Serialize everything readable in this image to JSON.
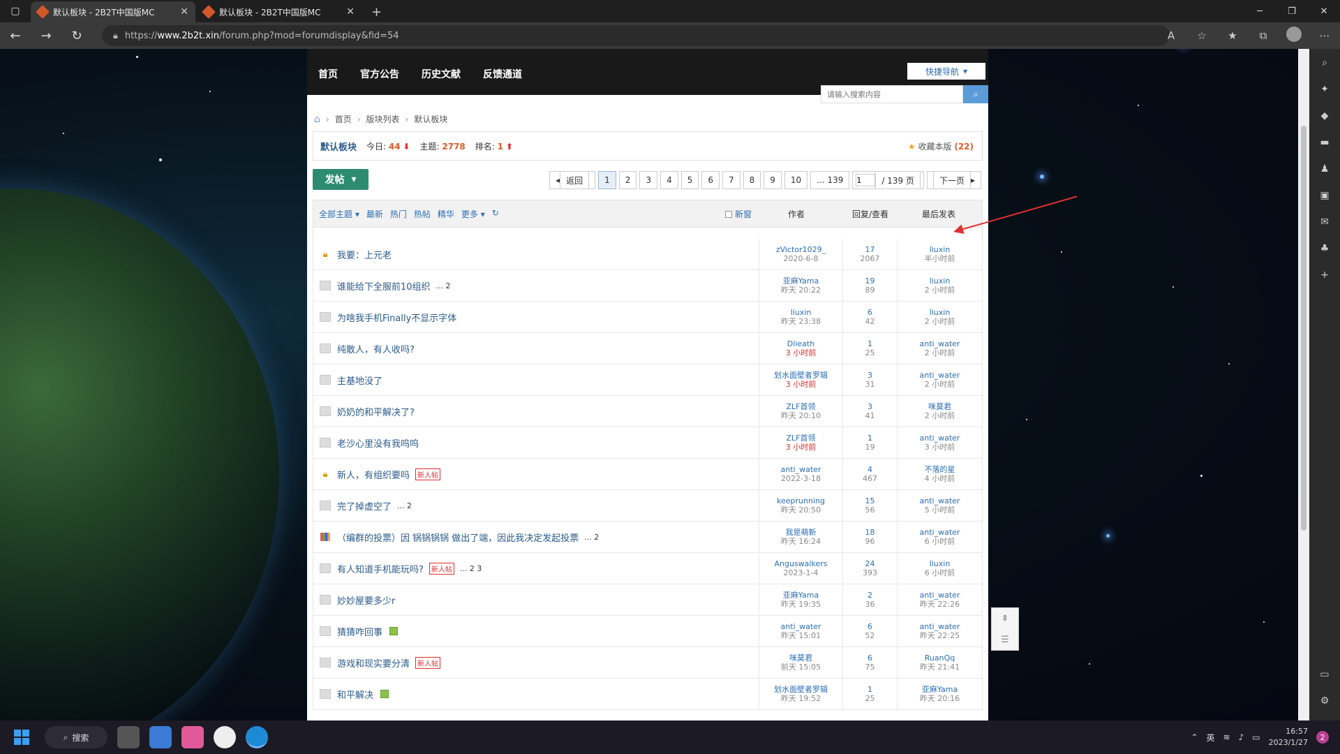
{
  "browser": {
    "tabs": [
      {
        "title": "默认板块 - 2B2T中国版MC",
        "active": true
      },
      {
        "title": "默认板块 - 2B2T中国版MC",
        "active": false
      }
    ],
    "url_prefix": "https://",
    "url_host": "www.2b2t.xin",
    "url_path": "/forum.php?mod=forumdisplay&fid=54"
  },
  "site": {
    "nav": [
      "首页",
      "官方公告",
      "历史文献",
      "反馈通道"
    ],
    "quick_nav": "快捷导航",
    "search_placeholder": "请输入搜索内容"
  },
  "breadcrumb": [
    "首页",
    "版块列表",
    "默认板块"
  ],
  "forum": {
    "name": "默认板块",
    "today_label": "今日:",
    "today": "44",
    "topics_label": "主题:",
    "topics": "2778",
    "rank_label": "排名:",
    "rank": "1",
    "favorite_label": "收藏本版",
    "favorite_count": "(22)"
  },
  "post_button": "发帖",
  "pager": {
    "back": "返回",
    "pages": [
      "1",
      "2",
      "3",
      "4",
      "5",
      "6",
      "7",
      "8",
      "9",
      "10",
      "... 139"
    ],
    "current": "1",
    "input_value": "1",
    "total": "/ 139 页",
    "next": "下一页"
  },
  "table": {
    "filters": [
      "全部主题",
      "最新",
      "热门",
      "热帖",
      "精华",
      "更多"
    ],
    "new_window": "新窗",
    "col_author": "作者",
    "col_reply": "回复/查看",
    "col_last": "最后发表",
    "rows": [
      {
        "icon": "lock",
        "title": "我要：上元老",
        "tag": "",
        "pages": "",
        "image": false,
        "author": "zVictor1029_",
        "date": "2020-6-8",
        "date_red": false,
        "replies": "17",
        "views": "2067",
        "last_user": "liuxin",
        "last_time": "半小时前"
      },
      {
        "icon": "folder",
        "title": "谁能给下全服前10组织",
        "tag": "",
        "pages": "... 2",
        "image": false,
        "author": "亚麻Yama",
        "date": "昨天 20:22",
        "date_red": false,
        "replies": "19",
        "views": "89",
        "last_user": "liuxin",
        "last_time": "2 小时前"
      },
      {
        "icon": "folder",
        "title": "为啥我手机Finally不显示字体",
        "tag": "",
        "pages": "",
        "image": false,
        "author": "liuxin",
        "date": "昨天 23:38",
        "date_red": false,
        "replies": "6",
        "views": "42",
        "last_user": "liuxin",
        "last_time": "2 小时前"
      },
      {
        "icon": "folder",
        "title": "纯散人，有人收吗?",
        "tag": "",
        "pages": "",
        "image": false,
        "author": "Dlieath",
        "date": "3 小时前",
        "date_red": true,
        "replies": "1",
        "views": "25",
        "last_user": "anti_water",
        "last_time": "2 小时前"
      },
      {
        "icon": "folder",
        "title": "主基地没了",
        "tag": "",
        "pages": "",
        "image": false,
        "author": "划水面壁者罗辑",
        "date": "3 小时前",
        "date_red": true,
        "replies": "3",
        "views": "31",
        "last_user": "anti_water",
        "last_time": "2 小时前"
      },
      {
        "icon": "folder",
        "title": "奶奶的和平解决了?",
        "tag": "",
        "pages": "",
        "image": false,
        "author": "ZLF首领",
        "date": "昨天 20:10",
        "date_red": false,
        "replies": "3",
        "views": "41",
        "last_user": "咪莫君",
        "last_time": "2 小时前"
      },
      {
        "icon": "folder",
        "title": "老沙心里没有我呜呜",
        "tag": "",
        "pages": "",
        "image": false,
        "author": "ZLF首领",
        "date": "3 小时前",
        "date_red": true,
        "replies": "1",
        "views": "19",
        "last_user": "anti_water",
        "last_time": "3 小时前"
      },
      {
        "icon": "lock",
        "title": "新人，有组织要吗",
        "tag": "新人帖",
        "pages": "",
        "image": false,
        "author": "anti_water",
        "date": "2022-3-18",
        "date_red": false,
        "replies": "4",
        "views": "467",
        "last_user": "不落的星",
        "last_time": "4 小时前"
      },
      {
        "icon": "folder",
        "title": "完了掉虚空了",
        "tag": "",
        "pages": "... 2",
        "image": false,
        "author": "keeprunning",
        "date": "昨天 20:50",
        "date_red": false,
        "replies": "15",
        "views": "56",
        "last_user": "anti_water",
        "last_time": "5 小时前"
      },
      {
        "icon": "poll",
        "title": "（编群的投票）因 锅锅锅锅 做出了端，因此我决定发起投票",
        "tag": "",
        "pages": "... 2",
        "image": false,
        "author": "我是萌新",
        "date": "昨天 16:24",
        "date_red": false,
        "replies": "18",
        "views": "96",
        "last_user": "anti_water",
        "last_time": "6 小时前"
      },
      {
        "icon": "folder",
        "title": "有人知道手机能玩吗?",
        "tag": "新人帖",
        "pages": "... 2  3",
        "image": false,
        "author": "Anguswalkers",
        "date": "2023-1-4",
        "date_red": false,
        "replies": "24",
        "views": "393",
        "last_user": "liuxin",
        "last_time": "6 小时前"
      },
      {
        "icon": "folder",
        "title": "妙妙屋要多少r",
        "tag": "",
        "pages": "",
        "image": false,
        "author": "亚麻Yama",
        "date": "昨天 19:35",
        "date_red": false,
        "replies": "2",
        "views": "36",
        "last_user": "anti_water",
        "last_time": "昨天 22:26"
      },
      {
        "icon": "folder",
        "title": "猜猜咋回事",
        "tag": "",
        "pages": "",
        "image": true,
        "author": "anti_water",
        "date": "昨天 15:01",
        "date_red": false,
        "replies": "6",
        "views": "52",
        "last_user": "anti_water",
        "last_time": "昨天 22:25"
      },
      {
        "icon": "folder",
        "title": "游戏和现实要分清",
        "tag": "新人帖",
        "pages": "",
        "image": false,
        "author": "咪莫君",
        "date": "前天 15:05",
        "date_red": false,
        "replies": "6",
        "views": "75",
        "last_user": "RuanQq",
        "last_time": "昨天 21:41"
      },
      {
        "icon": "folder",
        "title": "和平解决",
        "tag": "",
        "pages": "",
        "image": true,
        "author": "划水面壁者罗辑",
        "date": "昨天 19:52",
        "date_red": false,
        "replies": "1",
        "views": "25",
        "last_user": "亚麻Yama",
        "last_time": "昨天 20:16"
      }
    ]
  },
  "taskbar": {
    "search": "搜索",
    "ime": "英",
    "time": "16:57",
    "date": "2023/1/27",
    "notifications": "2"
  }
}
